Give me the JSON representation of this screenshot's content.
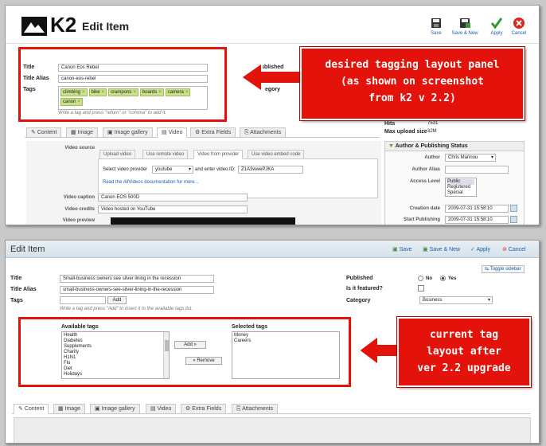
{
  "top": {
    "logo": "K2",
    "title": "Edit Item",
    "toolbar": {
      "save": "Save",
      "save_new": "Save & New",
      "apply": "Apply",
      "cancel": "Cancel"
    },
    "form": {
      "title_label": "Title",
      "title_value": "Canon Eos Rebel",
      "alias_label": "Title Alias",
      "alias_value": "canon-eos-rebel",
      "tags_label": "Tags",
      "tags": [
        "climbing",
        "bike",
        "crampons",
        "boards",
        "camera",
        "canon"
      ],
      "tags_hint": "Write a tag and press \"return\" or \"comma\" to add it.",
      "published_label": "Published",
      "category_fragment": "egory"
    },
    "callout": [
      "desired tagging layout panel",
      "(as shown on screenshot",
      "from k2  v 2.2)"
    ],
    "tabs": [
      "Content",
      "Image",
      "Image gallery",
      "Video",
      "Extra Fields",
      "Attachments"
    ],
    "video": {
      "source_label": "Video source",
      "subtabs": [
        "Upload video",
        "Use remote video",
        "Video from provider",
        "Use video embed code"
      ],
      "provider_label": "Select video provider",
      "provider_value": "youtube",
      "id_label": "and enter video ID:",
      "id_value": "Z1A3wwePJKA",
      "docs_link": "Read the AllVideos documentation for more...",
      "caption_label": "Video caption",
      "caption_value": "Canon EOS 500D",
      "credits_label": "Video credits",
      "credits_value": "Video hosted on YouTube",
      "preview_label": "Video preview"
    },
    "side": {
      "hits_label": "Hits",
      "hits_value": "7531",
      "max_upload_label": "Max upload size",
      "max_upload_value": "32M",
      "section_title": "Author & Publishing Status",
      "author_label": "Author",
      "author_value": "Chris Marinou",
      "author_alias_label": "Author Alias",
      "access_label": "Access Level",
      "access_options": [
        "Public",
        "Registered",
        "Special"
      ],
      "creation_label": "Creation date",
      "creation_value": "2009-07-31 15:58:10",
      "start_label": "Start Publishing",
      "start_value": "2009-07-31 15:58:10"
    }
  },
  "bottom": {
    "title": "Edit Item",
    "toolbar": {
      "save": "Save",
      "save_new": "Save & New",
      "apply": "Apply",
      "cancel": "Cancel"
    },
    "toggle_sidebar": "Toggle sidebar",
    "form": {
      "title_label": "Title",
      "title_value": "Small-business owners see silver lining in the recession",
      "alias_label": "Title Alias",
      "alias_value": "small-business-owners-see-silver-lining-in-the-recession",
      "tags_label": "Tags",
      "add_button": "Add",
      "tags_hint": "Write a tag and press \"Add\" to insert it to the available tags list.",
      "available_label": "Available tags",
      "available_tags": [
        "Health",
        "Diabetes",
        "Supplements",
        "Charity",
        "H1N1",
        "Flu",
        "Diet",
        "Holidays"
      ],
      "selected_label": "Selected tags",
      "selected_tags": [
        "Money",
        "Careers"
      ],
      "add_btn": "Add »",
      "remove_btn": "« Remove",
      "published_label": "Published",
      "no_label": "No",
      "yes_label": "Yes",
      "featured_label": "Is it featured?",
      "category_label": "Category",
      "category_value": "Business"
    },
    "callout": [
      "current tag",
      "layout after",
      "ver 2.2 upgrade"
    ],
    "tabs": [
      "Content",
      "Image",
      "Image gallery",
      "Video",
      "Extra Fields",
      "Attachments"
    ]
  },
  "colors": {
    "accent_red": "#e3120b",
    "tag_green": "#c9e08c",
    "link_blue": "#1a5fa8"
  }
}
